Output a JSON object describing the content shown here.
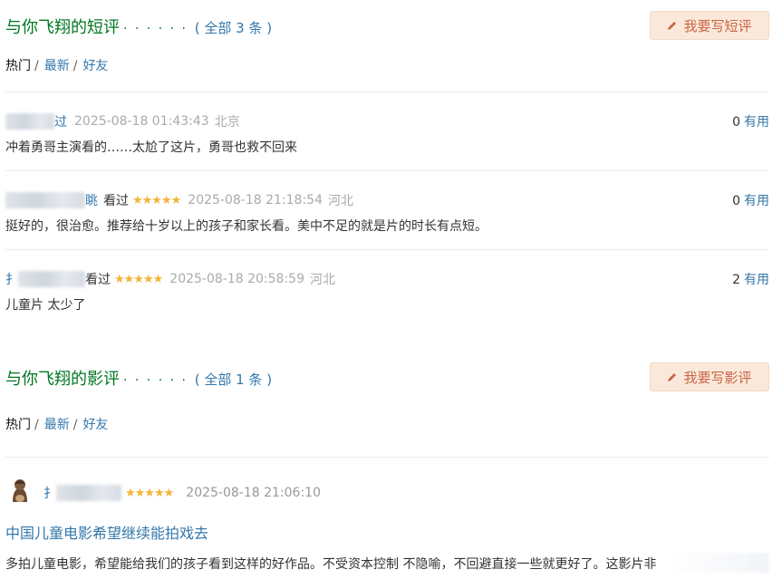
{
  "short_comments": {
    "title": "与你飞翔的短评",
    "dots": "· · · · · ·",
    "count_open": "(",
    "count_label": "全部 3 条",
    "count_close": ")",
    "write_button": "我要写短评",
    "tabs": [
      {
        "label": "热门",
        "active": true
      },
      {
        "label": "最新",
        "active": false
      },
      {
        "label": "好友",
        "active": false
      }
    ],
    "tab_separator": "/",
    "items": [
      {
        "user_visible": "过",
        "status": "",
        "stars": "",
        "time": "2025-08-18 01:43:43",
        "location": "北京",
        "votes": "0",
        "useful_label": "有用",
        "text": "冲着勇哥主演看的……太尬了这片，勇哥也救不回来"
      },
      {
        "user_visible": "眺",
        "status": "看过",
        "stars": "★★★★★",
        "time": "2025-08-18 21:18:54",
        "location": "河北",
        "votes": "0",
        "useful_label": "有用",
        "text": "挺好的，很治愈。推荐给十岁以上的孩子和家长看。美中不足的就是片的时长有点短。"
      },
      {
        "user_visible": "扌",
        "status": "看过",
        "stars": "★★★★★",
        "time": "2025-08-18 20:58:59",
        "location": "河北",
        "votes": "2",
        "useful_label": "有用",
        "text": "儿童片 太少了"
      }
    ]
  },
  "reviews": {
    "title": "与你飞翔的影评",
    "dots": "· · · · · ·",
    "count_open": "(",
    "count_label": "全部 1 条",
    "count_close": ")",
    "write_button": "我要写影评",
    "tabs": [
      {
        "label": "热门",
        "active": true
      },
      {
        "label": "最新",
        "active": false
      },
      {
        "label": "好友",
        "active": false
      }
    ],
    "tab_separator": "/",
    "item": {
      "user_visible": "扌",
      "stars": "★★★★★",
      "time": "2025-08-18 21:06:10",
      "title": "中国儿童电影希望继续能拍戏去",
      "body": "多拍儿童电影，希望能给我们的孩子看到这样的好作品。不受资本控制 不隐喻，不回避直接一些就更好了。这影片非"
    }
  },
  "colors": {
    "title_green": "#007722",
    "link_blue": "#3377aa",
    "star_gold": "#f3b437",
    "button_bg": "#fae9da",
    "button_text": "#ca6445",
    "meta_gray": "#aaaaaa"
  },
  "icons": {
    "write": "pencil-icon",
    "avatar": "avatar-icon"
  }
}
